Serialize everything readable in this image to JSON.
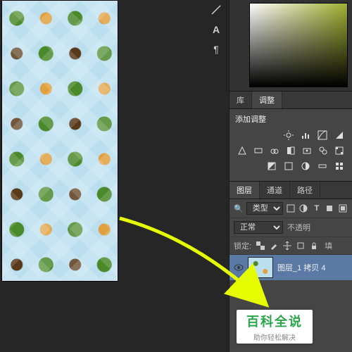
{
  "tool_column": {
    "icons": [
      "line-segment",
      "text-tool",
      "paragraph-tool"
    ]
  },
  "tabs_group1": {
    "library": "库",
    "adjustments": "调整"
  },
  "adjustments_panel": {
    "title": "添加调整",
    "row1": [
      "brightness",
      "levels",
      "curves",
      "exposure"
    ],
    "row2": [
      "vibrance",
      "hue",
      "color-balance",
      "bw",
      "photo-filter",
      "channel-mixer",
      "lookup"
    ],
    "row3": [
      "invert",
      "posterize",
      "threshold",
      "gradient-map",
      "selective-color"
    ]
  },
  "layers_tabs": {
    "layers": "图层",
    "channels": "通道",
    "paths": "路径"
  },
  "layers_panel": {
    "kind_label": "类型",
    "filter_icons": [
      "filter-image",
      "filter-adjustment",
      "filter-text",
      "filter-shape",
      "filter-smart"
    ],
    "blend_mode": "正常",
    "opacity_label": "不透明",
    "lock_label": "锁定:",
    "lock_icons": [
      "lock-transparent",
      "lock-paint",
      "lock-position",
      "lock-artboard",
      "lock-all"
    ],
    "fill_label": "填",
    "active_layer_name": "图层_1 拷贝 4"
  },
  "watermark": {
    "title": "百科全说",
    "subtitle": "助你轻松解决"
  }
}
